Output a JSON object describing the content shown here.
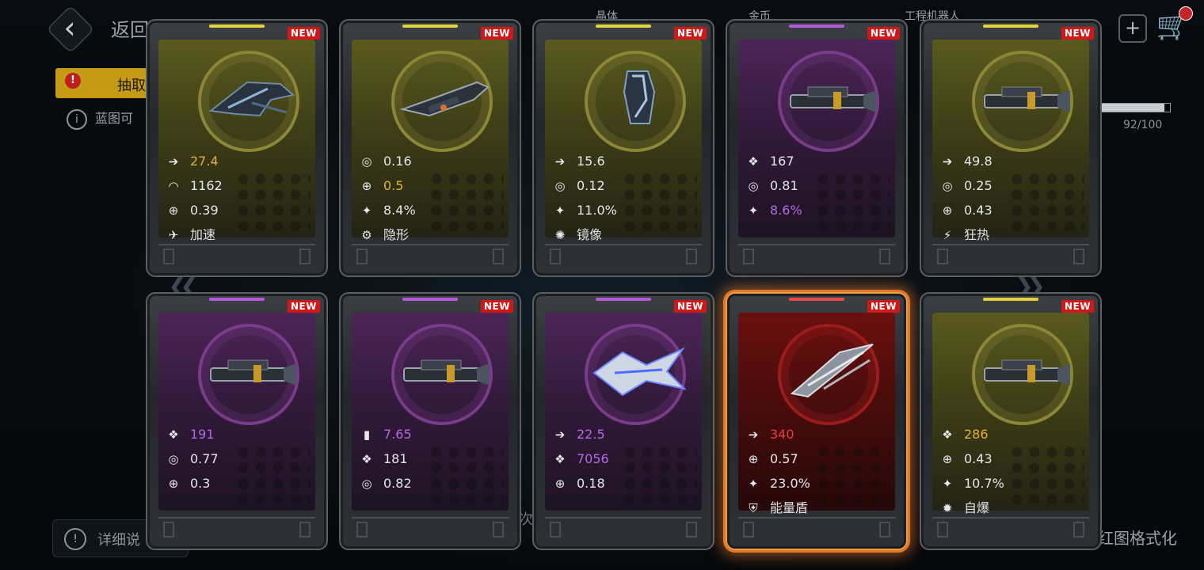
{
  "topbar": {
    "back_label": "返回",
    "res1": "晶体",
    "res2": "金币",
    "res3": "工程机器人"
  },
  "background": {
    "active_tab_label": "抽取",
    "info_text": "蓝图可",
    "progress_text": "92/100",
    "progress_fraction": 0.92,
    "footer_left": "详细说",
    "footer_mid": "次",
    "footer_right": "红图格式化"
  },
  "new_badge": "NEW",
  "cards": [
    {
      "rarity": "gold",
      "ship": "fighter",
      "stats": [
        {
          "icon": "speed-icon",
          "glyph": "➔",
          "value": "27.4",
          "color": "gold"
        },
        {
          "icon": "armor-icon",
          "glyph": "◠",
          "value": "1162",
          "color": ""
        },
        {
          "icon": "accuracy-icon",
          "glyph": "⊕",
          "value": "0.39",
          "color": ""
        },
        {
          "icon": "skill-icon",
          "glyph": "✈",
          "value": "加速",
          "color": "skill"
        }
      ]
    },
    {
      "rarity": "gold",
      "ship": "gunship",
      "stats": [
        {
          "icon": "shield-ring-icon",
          "glyph": "◎",
          "value": "0.16",
          "color": ""
        },
        {
          "icon": "accuracy-icon",
          "glyph": "⊕",
          "value": "0.5",
          "color": "gold"
        },
        {
          "icon": "crit-icon",
          "glyph": "✦",
          "value": "8.4%",
          "color": ""
        },
        {
          "icon": "skill-icon",
          "glyph": "⚙",
          "value": "隐形",
          "color": "skill"
        }
      ]
    },
    {
      "rarity": "gold",
      "ship": "pod",
      "stats": [
        {
          "icon": "speed-icon",
          "glyph": "➔",
          "value": "15.6",
          "color": ""
        },
        {
          "icon": "shield-ring-icon",
          "glyph": "◎",
          "value": "0.12",
          "color": ""
        },
        {
          "icon": "crit-icon",
          "glyph": "✦",
          "value": "11.0%",
          "color": ""
        },
        {
          "icon": "skill-icon",
          "glyph": "✺",
          "value": "镜像",
          "color": "skill"
        }
      ]
    },
    {
      "rarity": "purple",
      "ship": "cannon",
      "stats": [
        {
          "icon": "hp-icon",
          "glyph": "❖",
          "value": "167",
          "color": ""
        },
        {
          "icon": "shield-ring-icon",
          "glyph": "◎",
          "value": "0.81",
          "color": ""
        },
        {
          "icon": "crit-icon",
          "glyph": "✦",
          "value": "8.6%",
          "color": "purple"
        }
      ]
    },
    {
      "rarity": "gold",
      "ship": "cannon",
      "stats": [
        {
          "icon": "speed-icon",
          "glyph": "➔",
          "value": "49.8",
          "color": ""
        },
        {
          "icon": "shield-ring-icon",
          "glyph": "◎",
          "value": "0.25",
          "color": ""
        },
        {
          "icon": "accuracy-icon",
          "glyph": "⊕",
          "value": "0.43",
          "color": ""
        },
        {
          "icon": "skill-icon",
          "glyph": "⚡",
          "value": "狂热",
          "color": "skill"
        }
      ]
    },
    {
      "rarity": "purple",
      "ship": "cannon",
      "stats": [
        {
          "icon": "hp-icon",
          "glyph": "❖",
          "value": "191",
          "color": "purple"
        },
        {
          "icon": "shield-ring-icon",
          "glyph": "◎",
          "value": "0.77",
          "color": ""
        },
        {
          "icon": "accuracy-icon",
          "glyph": "⊕",
          "value": "0.3",
          "color": ""
        }
      ]
    },
    {
      "rarity": "purple",
      "ship": "cannon",
      "stats": [
        {
          "icon": "ammo-icon",
          "glyph": "▮",
          "value": "7.65",
          "color": "purple"
        },
        {
          "icon": "hp-icon",
          "glyph": "❖",
          "value": "181",
          "color": ""
        },
        {
          "icon": "shield-ring-icon",
          "glyph": "◎",
          "value": "0.82",
          "color": ""
        }
      ]
    },
    {
      "rarity": "purple",
      "ship": "crystal",
      "stats": [
        {
          "icon": "speed-icon",
          "glyph": "➔",
          "value": "22.5",
          "color": "purple"
        },
        {
          "icon": "hp-icon",
          "glyph": "❖",
          "value": "7056",
          "color": "purple"
        },
        {
          "icon": "accuracy-icon",
          "glyph": "⊕",
          "value": "0.18",
          "color": ""
        }
      ]
    },
    {
      "rarity": "red",
      "ship": "interceptor",
      "highlight": true,
      "stats": [
        {
          "icon": "speed-icon",
          "glyph": "➔",
          "value": "340",
          "color": "red"
        },
        {
          "icon": "accuracy-icon",
          "glyph": "⊕",
          "value": "0.57",
          "color": ""
        },
        {
          "icon": "crit-icon",
          "glyph": "✦",
          "value": "23.0%",
          "color": ""
        },
        {
          "icon": "skill-icon",
          "glyph": "⛨",
          "value": "能量盾",
          "color": "skill"
        }
      ]
    },
    {
      "rarity": "gold",
      "ship": "cannon",
      "stats": [
        {
          "icon": "hp-icon",
          "glyph": "❖",
          "value": "286",
          "color": "gold"
        },
        {
          "icon": "accuracy-icon",
          "glyph": "⊕",
          "value": "0.43",
          "color": ""
        },
        {
          "icon": "crit-icon",
          "glyph": "✦",
          "value": "10.7%",
          "color": ""
        },
        {
          "icon": "skill-icon",
          "glyph": "✹",
          "value": "自爆",
          "color": "skill"
        }
      ]
    }
  ],
  "colors": {
    "gold_rail": "#e3d23a",
    "purple_rail": "#b25ad8",
    "red_rail": "#e84a4a"
  }
}
